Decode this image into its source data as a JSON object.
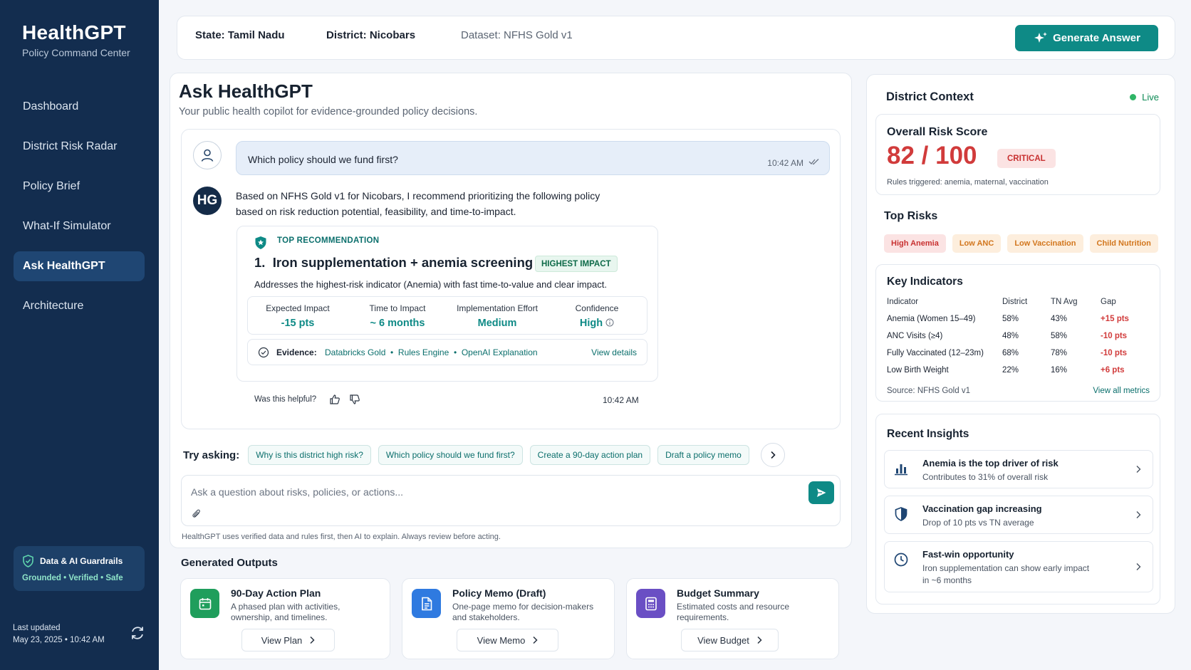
{
  "brand": {
    "title": "HealthGPT",
    "subtitle": "Policy Command Center"
  },
  "nav": [
    {
      "label": "Dashboard"
    },
    {
      "label": "District Risk Radar"
    },
    {
      "label": "Policy Brief"
    },
    {
      "label": "What-If Simulator"
    },
    {
      "label": "Ask HealthGPT",
      "active": true
    },
    {
      "label": "Architecture"
    }
  ],
  "guardrails": {
    "title": "Data & AI Guardrails",
    "tags": "Grounded • Verified • Safe"
  },
  "updated": {
    "label": "Last updated",
    "value": "May 23, 2025 • 10:42 AM"
  },
  "topbar": {
    "state": "State: Tamil Nadu",
    "district": "District: Nicobars",
    "dataset": "Dataset: NFHS Gold v1",
    "generate_label": "Generate Answer"
  },
  "ask": {
    "title": "Ask HealthGPT",
    "subtitle": "Your public health copilot for evidence-grounded policy decisions.",
    "question": "Which policy should we fund first?",
    "question_time": "10:42 AM",
    "avatar_initials": "HG",
    "answer_line1": "Based on NFHS Gold v1 for Nicobars, I recommend prioritizing the following policy",
    "answer_line2": "based on risk reduction potential, feasibility, and time-to-impact.",
    "recommendation": {
      "label": "TOP RECOMMENDATION",
      "title": "1.  Iron supplementation + anemia screening",
      "badge": "HIGHEST IMPACT",
      "description": "Addresses the highest-risk indicator (Anemia) with fast time-to-value and clear impact.",
      "metrics": [
        {
          "label": "Expected Impact",
          "value": "-15 pts"
        },
        {
          "label": "Time to Impact",
          "value": "~ 6 months"
        },
        {
          "label": "Implementation Effort",
          "value": "Medium"
        },
        {
          "label": "Confidence",
          "value": "High"
        }
      ],
      "evidence_label": "Evidence:",
      "evidence_sources": "Databricks Gold  •  Rules Engine  •  OpenAI Explanation",
      "view_details": "View details"
    },
    "helpful": "Was this helpful?",
    "answer_time": "10:42 AM",
    "try_label": "Try asking:",
    "suggestions": [
      "Why is this district high risk?",
      "Which policy should we fund first?",
      "Create a 90-day action plan",
      "Draft a policy memo"
    ],
    "input_placeholder": "Ask a question about risks, policies, or actions...",
    "disclaimer": "HealthGPT uses verified data and rules first, then AI to explain. Always review before acting."
  },
  "outputs": {
    "heading": "Generated Outputs",
    "cards": [
      {
        "title": "90-Day Action Plan",
        "desc": "A phased plan with activities, ownership, and timelines.",
        "button": "View Plan",
        "color": "#1f9e5c"
      },
      {
        "title": "Policy Memo (Draft)",
        "desc": "One-page memo for decision-makers and stakeholders.",
        "button": "View Memo",
        "color": "#2f7ae0"
      },
      {
        "title": "Budget Summary",
        "desc": "Estimated costs and resource requirements.",
        "button": "View Budget",
        "color": "#6a4fc4"
      }
    ]
  },
  "context": {
    "title": "District Context",
    "live": "Live",
    "risk": {
      "label": "Overall Risk Score",
      "value": "82 / 100",
      "badge": "CRITICAL",
      "rules": "Rules triggered: anemia, maternal, vaccination"
    },
    "top_risks_heading": "Top Risks",
    "top_risks": [
      {
        "label": "High Anemia",
        "bg": "#fbe3e3",
        "fg": "#c83131"
      },
      {
        "label": "Low ANC",
        "bg": "#fdeedd",
        "fg": "#d2761d"
      },
      {
        "label": "Low Vaccination",
        "bg": "#fdeedd",
        "fg": "#d2761d"
      },
      {
        "label": "Child Nutrition",
        "bg": "#fdeedd",
        "fg": "#d2761d"
      }
    ],
    "indicators": {
      "heading": "Key Indicators",
      "columns": [
        "Indicator",
        "District",
        "TN Avg",
        "Gap"
      ],
      "rows": [
        [
          "Anemia (Women 15–49)",
          "58%",
          "43%",
          "+15 pts"
        ],
        [
          "ANC Visits (≥4)",
          "48%",
          "58%",
          "-10 pts"
        ],
        [
          "Fully Vaccinated (12–23m)",
          "68%",
          "78%",
          "-10 pts"
        ],
        [
          "Low Birth Weight",
          "22%",
          "16%",
          "+6 pts"
        ]
      ],
      "source": "Source: NFHS Gold v1",
      "view_all": "View all metrics"
    },
    "insights": {
      "heading": "Recent Insights",
      "items": [
        {
          "title": "Anemia is the top driver of risk",
          "desc": "Contributes to 31% of overall risk"
        },
        {
          "title": "Vaccination gap increasing",
          "desc": "Drop of 10 pts vs TN average"
        },
        {
          "title": "Fast-win opportunity",
          "desc": "Iron supplementation can show early impact in ~6 months"
        }
      ]
    }
  },
  "colors": {
    "accent": "#0e8a86",
    "sidebar": "#132d4f",
    "critical": "#d13b3b"
  }
}
